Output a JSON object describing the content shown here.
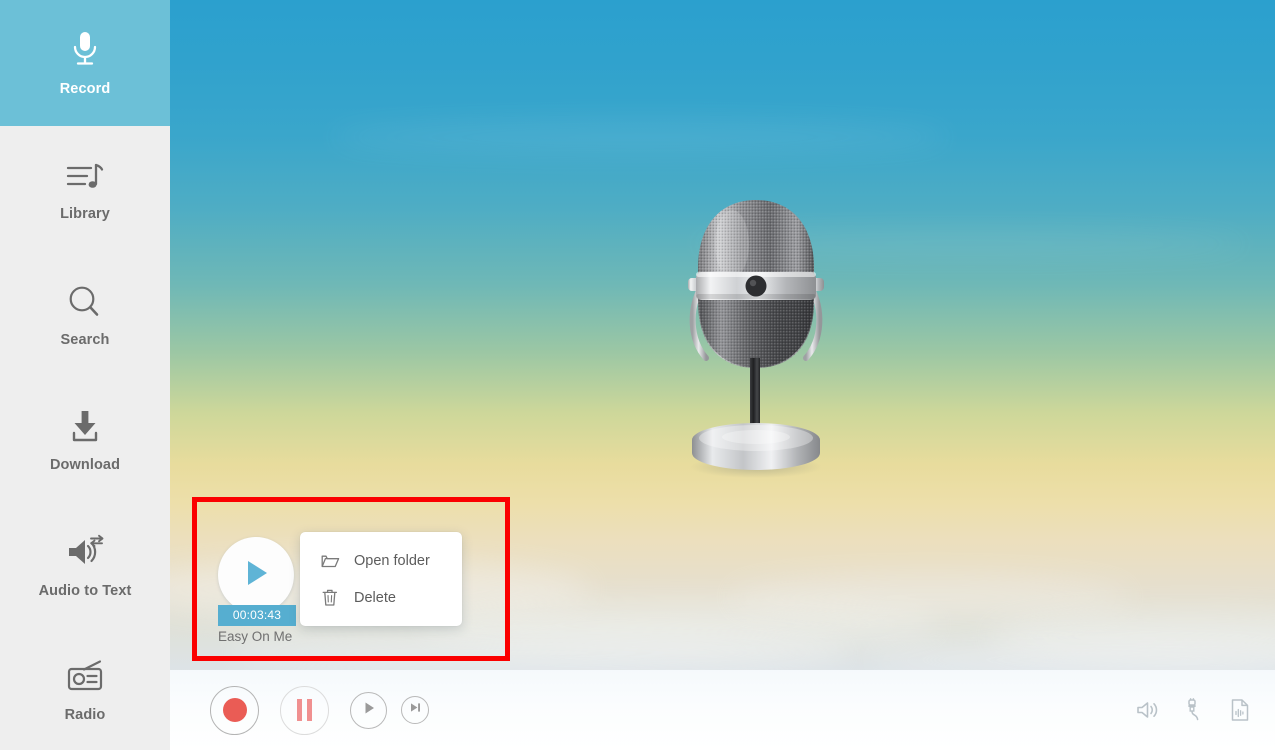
{
  "app": {
    "accent_color": "#6cc0d7",
    "sidebar_bg": "#eeeeee",
    "highlight_color": "#fb0000",
    "record_dot_color": "#ea5c55"
  },
  "sidebar": {
    "items": [
      {
        "label": "Record",
        "icon": "microphone-icon",
        "active": true
      },
      {
        "label": "Library",
        "icon": "music-list-icon",
        "active": false
      },
      {
        "label": "Search",
        "icon": "search-icon",
        "active": false
      },
      {
        "label": "Download",
        "icon": "download-icon",
        "active": false
      },
      {
        "label": "Audio to Text",
        "icon": "audio-to-text-icon",
        "active": false
      },
      {
        "label": "Radio",
        "icon": "radio-icon",
        "active": false
      }
    ]
  },
  "stage": {
    "artwork": "vintage-microphone-illustration"
  },
  "recording": {
    "title": "Easy On Me",
    "duration": "00:03:43",
    "play_icon": "play-icon"
  },
  "context_menu": {
    "items": [
      {
        "label": "Open folder",
        "icon": "folder-icon"
      },
      {
        "label": "Delete",
        "icon": "trash-icon"
      }
    ]
  },
  "toolbar": {
    "transport": [
      {
        "name": "record",
        "icon": "record-dot-icon"
      },
      {
        "name": "pause",
        "icon": "pause-icon"
      },
      {
        "name": "play",
        "icon": "play-icon"
      },
      {
        "name": "next",
        "icon": "skip-forward-icon"
      }
    ],
    "utilities": [
      {
        "name": "system-sound",
        "icon": "speaker-icon"
      },
      {
        "name": "microphone-input",
        "icon": "audio-jack-icon"
      },
      {
        "name": "output-file",
        "icon": "file-waveform-icon"
      }
    ]
  }
}
